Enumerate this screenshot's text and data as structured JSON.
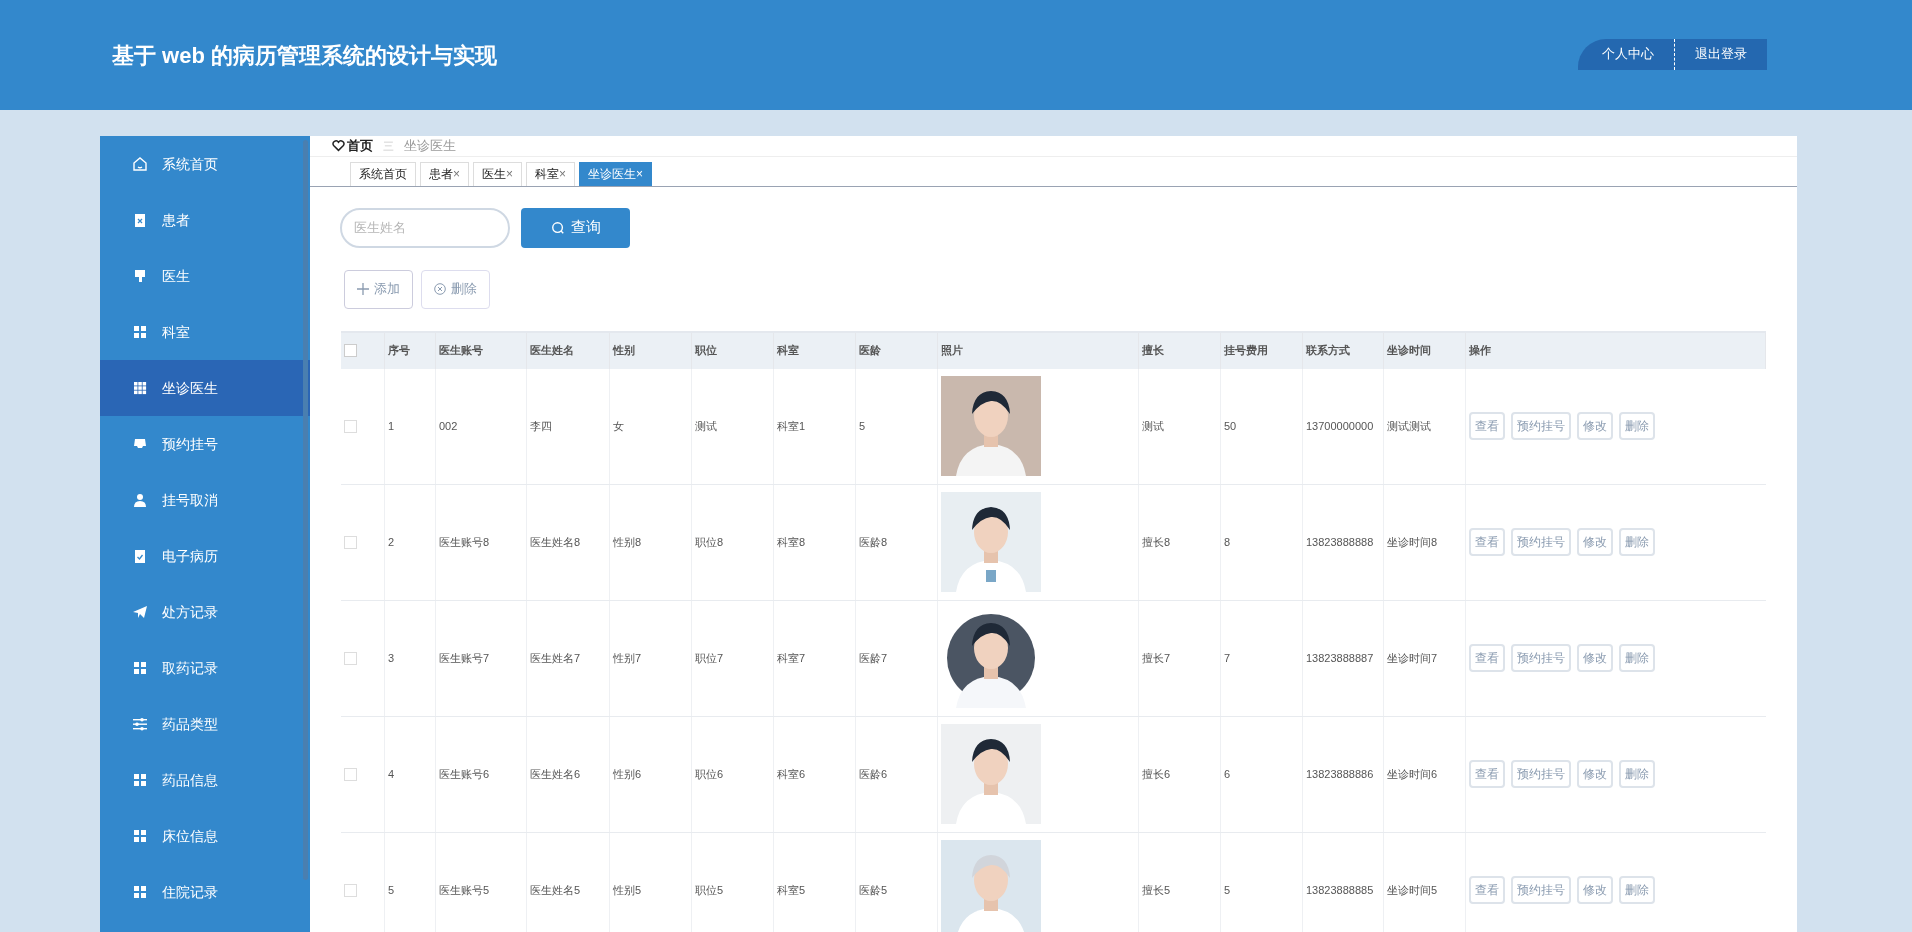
{
  "header": {
    "title": "基于 web 的病历管理系统的设计与实现",
    "actions": [
      "个人中心",
      "退出登录"
    ]
  },
  "sidebar": {
    "items": [
      {
        "label": "系统首页",
        "selected": false
      },
      {
        "label": "患者",
        "selected": false
      },
      {
        "label": "医生",
        "selected": false
      },
      {
        "label": "科室",
        "selected": false
      },
      {
        "label": "坐诊医生",
        "selected": true
      },
      {
        "label": "预约挂号",
        "selected": false
      },
      {
        "label": "挂号取消",
        "selected": false
      },
      {
        "label": "电子病历",
        "selected": false
      },
      {
        "label": "处方记录",
        "selected": false
      },
      {
        "label": "取药记录",
        "selected": false
      },
      {
        "label": "药品类型",
        "selected": false
      },
      {
        "label": "药品信息",
        "selected": false
      },
      {
        "label": "床位信息",
        "selected": false
      },
      {
        "label": "住院记录",
        "selected": false
      }
    ]
  },
  "breadcrumb": {
    "home": "首页",
    "separator": "三",
    "current": "坐诊医生"
  },
  "tabs": [
    {
      "label": "系统首页",
      "selected": false
    },
    {
      "label": "患者",
      "close": "×",
      "selected": false
    },
    {
      "label": "医生",
      "close": "×",
      "selected": false
    },
    {
      "label": "科室",
      "close": "×",
      "selected": false
    },
    {
      "label": "坐诊医生",
      "close": "×",
      "selected": true
    }
  ],
  "search": {
    "placeholder": "医生姓名",
    "button": "查询"
  },
  "toolbar": {
    "add": "添加",
    "delete": "删除"
  },
  "table": {
    "select_all": {
      "checked": false
    },
    "columns": [
      "序号",
      "医生账号",
      "医生姓名",
      "性别",
      "职位",
      "科室",
      "医龄",
      "照片",
      "擅长",
      "挂号费用",
      "联系方式",
      "坐诊时间",
      "操作"
    ],
    "rows": [
      {
        "checked": false,
        "cells": [
          "1",
          "002",
          "李四",
          "女",
          "测试",
          "科室1",
          "5",
          "",
          "测试",
          "50",
          "13700000000",
          "测试测试"
        ],
        "actions": [
          "查看",
          "预约挂号",
          "修改",
          "删除"
        ]
      },
      {
        "checked": false,
        "cells": [
          "2",
          "医生账号8",
          "医生姓名8",
          "性别8",
          "职位8",
          "科室8",
          "医龄8",
          "",
          "擅长8",
          "8",
          "13823888888",
          "坐诊时间8"
        ],
        "actions": [
          "查看",
          "预约挂号",
          "修改",
          "删除"
        ]
      },
      {
        "checked": false,
        "cells": [
          "3",
          "医生账号7",
          "医生姓名7",
          "性别7",
          "职位7",
          "科室7",
          "医龄7",
          "",
          "擅长7",
          "7",
          "13823888887",
          "坐诊时间7"
        ],
        "actions": [
          "查看",
          "预约挂号",
          "修改",
          "删除"
        ]
      },
      {
        "checked": false,
        "cells": [
          "4",
          "医生账号6",
          "医生姓名6",
          "性别6",
          "职位6",
          "科室6",
          "医龄6",
          "",
          "擅长6",
          "6",
          "13823888886",
          "坐诊时间6"
        ],
        "actions": [
          "查看",
          "预约挂号",
          "修改",
          "删除"
        ]
      },
      {
        "checked": false,
        "cells": [
          "5",
          "医生账号5",
          "医生姓名5",
          "性别5",
          "职位5",
          "科室5",
          "医龄5",
          "",
          "擅长5",
          "5",
          "13823888885",
          "坐诊时间5"
        ],
        "actions": [
          "查看",
          "预约挂号",
          "修改",
          "删除"
        ]
      }
    ]
  }
}
